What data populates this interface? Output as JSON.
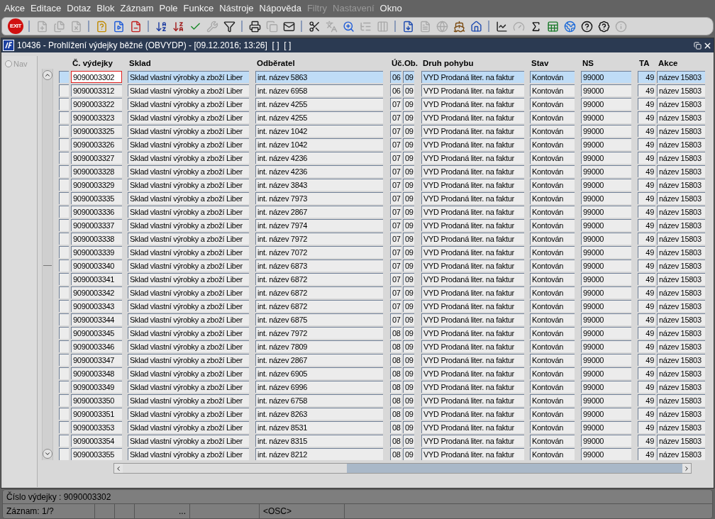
{
  "menu": [
    {
      "label": "Akce",
      "disabled": false
    },
    {
      "label": "Editace",
      "disabled": false
    },
    {
      "label": "Dotaz",
      "disabled": false
    },
    {
      "label": "Blok",
      "disabled": false
    },
    {
      "label": "Záznam",
      "disabled": false
    },
    {
      "label": "Pole",
      "disabled": false
    },
    {
      "label": "Funkce",
      "disabled": false
    },
    {
      "label": "Nástroje",
      "disabled": false
    },
    {
      "label": "Nápověda",
      "disabled": false
    },
    {
      "label": "Filtry",
      "disabled": true
    },
    {
      "label": "Nastavení",
      "disabled": true
    },
    {
      "label": "Okno",
      "disabled": false
    }
  ],
  "toolbar": [
    {
      "kind": "exit",
      "label": "EXIT",
      "disabled": false
    },
    {
      "kind": "sep"
    },
    {
      "kind": "insert",
      "disabled": true
    },
    {
      "kind": "copyrec",
      "disabled": true
    },
    {
      "kind": "delete",
      "disabled": true
    },
    {
      "kind": "sep"
    },
    {
      "kind": "query",
      "disabled": false
    },
    {
      "kind": "run",
      "disabled": false
    },
    {
      "kind": "cancel",
      "disabled": false
    },
    {
      "kind": "sep"
    },
    {
      "kind": "sortaz",
      "disabled": false
    },
    {
      "kind": "sortza",
      "disabled": false
    },
    {
      "kind": "check",
      "disabled": false
    },
    {
      "kind": "wrench",
      "disabled": true
    },
    {
      "kind": "filter",
      "disabled": false
    },
    {
      "kind": "sep"
    },
    {
      "kind": "print",
      "disabled": false
    },
    {
      "kind": "copy",
      "disabled": true
    },
    {
      "kind": "mail",
      "disabled": false
    },
    {
      "kind": "sep"
    },
    {
      "kind": "cut",
      "disabled": false
    },
    {
      "kind": "translate",
      "disabled": true
    },
    {
      "kind": "zoom",
      "disabled": false
    },
    {
      "kind": "list",
      "disabled": true
    },
    {
      "kind": "columns",
      "disabled": true
    },
    {
      "kind": "sep"
    },
    {
      "kind": "export",
      "disabled": false
    },
    {
      "kind": "doc",
      "disabled": true
    },
    {
      "kind": "globe",
      "disabled": true
    },
    {
      "kind": "wheel",
      "disabled": false
    },
    {
      "kind": "home",
      "disabled": false
    },
    {
      "kind": "sep"
    },
    {
      "kind": "chart",
      "disabled": false
    },
    {
      "kind": "gauge",
      "disabled": true
    },
    {
      "kind": "sigma",
      "disabled": false
    },
    {
      "kind": "excel",
      "disabled": false
    },
    {
      "kind": "browser",
      "disabled": false
    },
    {
      "kind": "help",
      "disabled": false
    },
    {
      "kind": "helpwin",
      "disabled": false
    },
    {
      "kind": "info",
      "disabled": true
    }
  ],
  "window": {
    "title": "10436 - Prohlížení výdejky běžné (OBVYDP) - [09.12.2016; 13:26]  [ ]  [ ]"
  },
  "nav": {
    "label": "Nav",
    "checked": false,
    "disabled": true
  },
  "table": {
    "columns": [
      "Č. výdejky",
      "Sklad",
      "Odběratel",
      "Úč.Ob.",
      "Druh pohybu",
      "Stav",
      "NS",
      "TA",
      "Akce"
    ],
    "rows": [
      {
        "selected": true,
        "cells": [
          "9090003302",
          "Sklad vlastní výrobky a zboží Liber",
          "int. název 5863",
          [
            "06",
            "09"
          ],
          "VYD Prodaná liter. na faktur",
          "Kontován",
          "99000",
          "49",
          "název 15803"
        ]
      },
      {
        "selected": false,
        "cells": [
          "9090003312",
          "Sklad vlastní výrobky a zboží Liber",
          "int. název 6958",
          [
            "06",
            "09"
          ],
          "VYD Prodaná liter. na faktur",
          "Kontován",
          "99000",
          "49",
          "název 15803"
        ]
      },
      {
        "selected": false,
        "cells": [
          "9090003322",
          "Sklad vlastní výrobky a zboží Liber",
          "int. název 4255",
          [
            "07",
            "09"
          ],
          "VYD Prodaná liter. na faktur",
          "Kontován",
          "99000",
          "49",
          "název 15803"
        ]
      },
      {
        "selected": false,
        "cells": [
          "9090003323",
          "Sklad vlastní výrobky a zboží Liber",
          "int. název 4255",
          [
            "07",
            "09"
          ],
          "VYD Prodaná liter. na faktur",
          "Kontován",
          "99000",
          "49",
          "název 15803"
        ]
      },
      {
        "selected": false,
        "cells": [
          "9090003325",
          "Sklad vlastní výrobky a zboží Liber",
          "int. název 1042",
          [
            "07",
            "09"
          ],
          "VYD Prodaná liter. na faktur",
          "Kontován",
          "99000",
          "49",
          "název 15803"
        ]
      },
      {
        "selected": false,
        "cells": [
          "9090003326",
          "Sklad vlastní výrobky a zboží Liber",
          "int. název 1042",
          [
            "07",
            "09"
          ],
          "VYD Prodaná liter. na faktur",
          "Kontován",
          "99000",
          "49",
          "název 15803"
        ]
      },
      {
        "selected": false,
        "cells": [
          "9090003327",
          "Sklad vlastní výrobky a zboží Liber",
          "int. název 4236",
          [
            "07",
            "09"
          ],
          "VYD Prodaná liter. na faktur",
          "Kontován",
          "99000",
          "49",
          "název 15803"
        ]
      },
      {
        "selected": false,
        "cells": [
          "9090003328",
          "Sklad vlastní výrobky a zboží Liber",
          "int. název 4236",
          [
            "07",
            "09"
          ],
          "VYD Prodaná liter. na faktur",
          "Kontován",
          "99000",
          "49",
          "název 15803"
        ]
      },
      {
        "selected": false,
        "cells": [
          "9090003329",
          "Sklad vlastní výrobky a zboží Liber",
          "int. název 3843",
          [
            "07",
            "09"
          ],
          "VYD Prodaná liter. na faktur",
          "Kontován",
          "99000",
          "49",
          "název 15803"
        ]
      },
      {
        "selected": false,
        "cells": [
          "9090003335",
          "Sklad vlastní výrobky a zboží Liber",
          "int. název 7973",
          [
            "07",
            "09"
          ],
          "VYD Prodaná liter. na faktur",
          "Kontován",
          "99000",
          "49",
          "název 15803"
        ]
      },
      {
        "selected": false,
        "cells": [
          "9090003336",
          "Sklad vlastní výrobky a zboží Liber",
          "int. název 2867",
          [
            "07",
            "09"
          ],
          "VYD Prodaná liter. na faktur",
          "Kontován",
          "99000",
          "49",
          "název 15803"
        ]
      },
      {
        "selected": false,
        "cells": [
          "9090003337",
          "Sklad vlastní výrobky a zboží Liber",
          "int. název 7974",
          [
            "07",
            "09"
          ],
          "VYD Prodaná liter. na faktur",
          "Kontován",
          "99000",
          "49",
          "název 15803"
        ]
      },
      {
        "selected": false,
        "cells": [
          "9090003338",
          "Sklad vlastní výrobky a zboží Liber",
          "int. název 7972",
          [
            "07",
            "09"
          ],
          "VYD Prodaná liter. na faktur",
          "Kontován",
          "99000",
          "49",
          "název 15803"
        ]
      },
      {
        "selected": false,
        "cells": [
          "9090003339",
          "Sklad vlastní výrobky a zboží Liber",
          "int. název 7072",
          [
            "07",
            "09"
          ],
          "VYD Prodaná liter. na faktur",
          "Kontován",
          "99000",
          "49",
          "název 15803"
        ]
      },
      {
        "selected": false,
        "cells": [
          "9090003340",
          "Sklad vlastní výrobky a zboží Liber",
          "int. název 6873",
          [
            "07",
            "09"
          ],
          "VYD Prodaná liter. na faktur",
          "Kontován",
          "99000",
          "49",
          "název 15803"
        ]
      },
      {
        "selected": false,
        "cells": [
          "9090003341",
          "Sklad vlastní výrobky a zboží Liber",
          "int. název 6872",
          [
            "07",
            "09"
          ],
          "VYD Prodaná liter. na faktur",
          "Kontován",
          "99000",
          "49",
          "název 15803"
        ]
      },
      {
        "selected": false,
        "cells": [
          "9090003342",
          "Sklad vlastní výrobky a zboží Liber",
          "int. název 6872",
          [
            "07",
            "09"
          ],
          "VYD Prodaná liter. na faktur",
          "Kontován",
          "99000",
          "49",
          "název 15803"
        ]
      },
      {
        "selected": false,
        "cells": [
          "9090003343",
          "Sklad vlastní výrobky a zboží Liber",
          "int. název 6872",
          [
            "07",
            "09"
          ],
          "VYD Prodaná liter. na faktur",
          "Kontován",
          "99000",
          "49",
          "název 15803"
        ]
      },
      {
        "selected": false,
        "cells": [
          "9090003344",
          "Sklad vlastní výrobky a zboží Liber",
          "int. název 6875",
          [
            "07",
            "09"
          ],
          "VYD Prodaná liter. na faktur",
          "Kontován",
          "99000",
          "49",
          "název 15803"
        ]
      },
      {
        "selected": false,
        "cells": [
          "9090003345",
          "Sklad vlastní výrobky a zboží Liber",
          "int. název 7972",
          [
            "08",
            "09"
          ],
          "VYD Prodaná liter. na faktur",
          "Kontován",
          "99000",
          "49",
          "název 15803"
        ]
      },
      {
        "selected": false,
        "cells": [
          "9090003346",
          "Sklad vlastní výrobky a zboží Liber",
          "int. název 7809",
          [
            "08",
            "09"
          ],
          "VYD Prodaná liter. na faktur",
          "Kontován",
          "99000",
          "49",
          "název 15803"
        ]
      },
      {
        "selected": false,
        "cells": [
          "9090003347",
          "Sklad vlastní výrobky a zboží Liber",
          "int. název 2867",
          [
            "08",
            "09"
          ],
          "VYD Prodaná liter. na faktur",
          "Kontován",
          "99000",
          "49",
          "název 15803"
        ]
      },
      {
        "selected": false,
        "cells": [
          "9090003348",
          "Sklad vlastní výrobky a zboží Liber",
          "int. název 6905",
          [
            "08",
            "09"
          ],
          "VYD Prodaná liter. na faktur",
          "Kontován",
          "99000",
          "49",
          "název 15803"
        ]
      },
      {
        "selected": false,
        "cells": [
          "9090003349",
          "Sklad vlastní výrobky a zboží Liber",
          "int. název 6996",
          [
            "08",
            "09"
          ],
          "VYD Prodaná liter. na faktur",
          "Kontován",
          "99000",
          "49",
          "název 15803"
        ]
      },
      {
        "selected": false,
        "cells": [
          "9090003350",
          "Sklad vlastní výrobky a zboží Liber",
          "int. název 6758",
          [
            "08",
            "09"
          ],
          "VYD Prodaná liter. na faktur",
          "Kontován",
          "99000",
          "49",
          "název 15803"
        ]
      },
      {
        "selected": false,
        "cells": [
          "9090003351",
          "Sklad vlastní výrobky a zboží Liber",
          "int. název 8263",
          [
            "08",
            "09"
          ],
          "VYD Prodaná liter. na faktur",
          "Kontován",
          "99000",
          "49",
          "název 15803"
        ]
      },
      {
        "selected": false,
        "cells": [
          "9090003353",
          "Sklad vlastní výrobky a zboží Liber",
          "int. název 8531",
          [
            "08",
            "09"
          ],
          "VYD Prodaná liter. na faktur",
          "Kontován",
          "99000",
          "49",
          "název 15803"
        ]
      },
      {
        "selected": false,
        "cells": [
          "9090003354",
          "Sklad vlastní výrobky a zboží Liber",
          "int. název 8315",
          [
            "08",
            "09"
          ],
          "VYD Prodaná liter. na faktur",
          "Kontován",
          "99000",
          "49",
          "název 15803"
        ]
      },
      {
        "selected": false,
        "cells": [
          "9090003355",
          "Sklad vlastní výrobky a zboží Liber",
          "int. název 8212",
          [
            "08",
            "09"
          ],
          "VYD Prodaná liter. na faktur",
          "Kontován",
          "99000",
          "49",
          "název 15803"
        ]
      }
    ]
  },
  "status_bar": {
    "message": "Číslo výdejky : 9090003302",
    "cells": [
      "Záznam: 1/?",
      "...",
      "<OSC>"
    ]
  }
}
